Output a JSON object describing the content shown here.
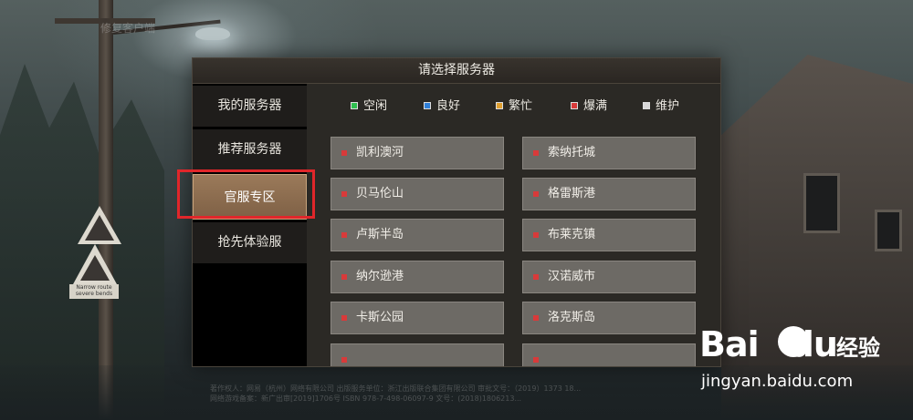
{
  "background": {
    "header_text": "修复客户端",
    "sign_text": "Narrow route severe bends",
    "footer_lines": [
      "著作权人：网易（杭州）网络有限公司    出版服务单位：浙江出版联合集团有限公司    审批文号：（2019）1373 18...",
      "网络游戏备案：新广出审[2019]1706号    ISBN 978-7-498-06097-9    文号：(2018)1806213..."
    ]
  },
  "dialog": {
    "title": "请选择服务器"
  },
  "sidebar": {
    "items": [
      {
        "label": "我的服务器"
      },
      {
        "label": "推荐服务器"
      },
      {
        "label": "官服专区",
        "selected": true
      },
      {
        "label": "抢先体验服"
      }
    ]
  },
  "legend": [
    {
      "label": "空闲",
      "color": "#2fbf4f"
    },
    {
      "label": "良好",
      "color": "#2f7fd8"
    },
    {
      "label": "繁忙",
      "color": "#e0a030"
    },
    {
      "label": "爆满",
      "color": "#d83a3a"
    },
    {
      "label": "维护",
      "color": "#d8d8d8"
    }
  ],
  "servers": [
    {
      "name": "凯利澳河",
      "status": "爆满"
    },
    {
      "name": "索纳托城",
      "status": "爆满"
    },
    {
      "name": "贝马伦山",
      "status": "爆满"
    },
    {
      "name": "格雷斯港",
      "status": "爆满"
    },
    {
      "name": "卢斯半岛",
      "status": "爆满"
    },
    {
      "name": "布莱克镇",
      "status": "爆满"
    },
    {
      "name": "纳尔逊港",
      "status": "爆满"
    },
    {
      "name": "汉诺威市",
      "status": "爆满"
    },
    {
      "name": "卡斯公园",
      "status": "爆满"
    },
    {
      "name": "洛克斯岛",
      "status": "爆满"
    },
    {
      "name": "",
      "status": "爆满"
    },
    {
      "name": "",
      "status": "爆满"
    }
  ],
  "watermark": {
    "logo_left": "Bai",
    "logo_right": "du",
    "suffix": "经验",
    "url": "jingyan.baidu.com"
  }
}
